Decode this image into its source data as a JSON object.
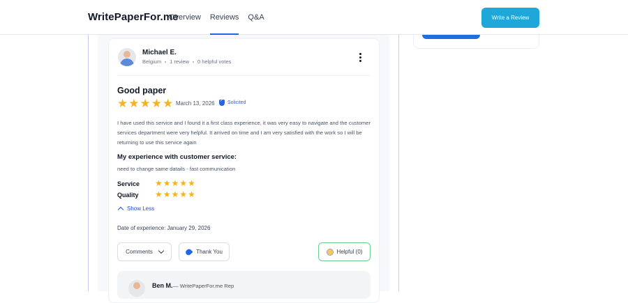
{
  "header": {
    "logo": "WritePaperFor.me",
    "nav": [
      "Overview",
      "Reviews",
      "Q&A"
    ],
    "active_nav": "Reviews",
    "write_review_label": "Write a Review"
  },
  "review": {
    "reviewer_name": "Michael E.",
    "country": "Belgium",
    "review_count": "1 review",
    "helpful_votes": "0 helpful votes",
    "title": "Good paper",
    "rating": 5,
    "date": "March 13, 2026",
    "badge": "Solicited",
    "body": "I have used this service and I found it a first class experience, it was very easy to navigate and the customer services department were very helpful. It arrived on time and I am very satisfied with the work so I will be returning to use this service again",
    "cs_title": "My experience with customer service:",
    "cs_text": "need to change same datails - fast communication",
    "ratings": [
      {
        "label": "Service",
        "stars": 5
      },
      {
        "label": "Quality",
        "stars": 5
      }
    ],
    "show_less_label": "Show Less",
    "experience_date": "Date of experience: January 29, 2026",
    "comments_label": "Comments",
    "thank_you_label": "Thank You",
    "helpful_label": "Helpful (0)"
  },
  "reply": {
    "name": "Ben M.",
    "role": "— WritePaperFor.me Rep"
  },
  "colors": {
    "accent": "#2563eb",
    "write_button": "#1fa7d9",
    "star": "#f6b21b",
    "helpful_border": "#6bd08f"
  }
}
